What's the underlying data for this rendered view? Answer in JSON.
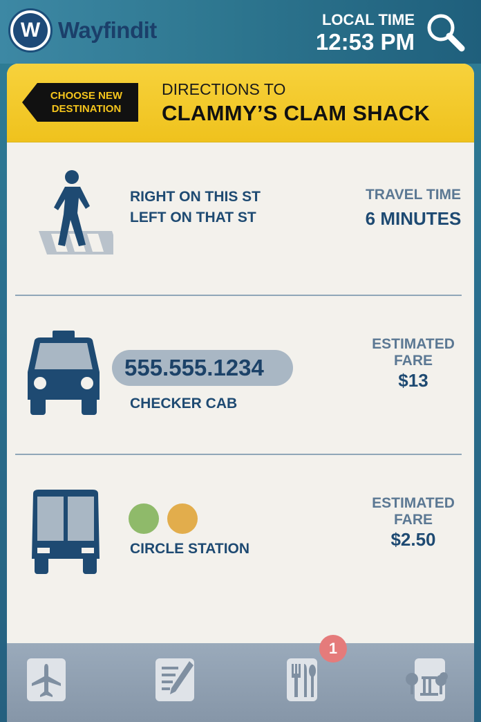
{
  "app": {
    "name": "Wayfindit",
    "logo_letter": "W"
  },
  "header": {
    "local_time_label": "LOCAL TIME",
    "local_time": "12:53 PM"
  },
  "destination": {
    "back_label_line1": "CHOOSE NEW",
    "back_label_line2": "DESTINATION",
    "label": "DIRECTIONS TO",
    "name": "CLAMMY’S CLAM SHACK"
  },
  "walk": {
    "line1": "RIGHT ON THIS ST",
    "line2": "LEFT ON THAT ST",
    "meta_label": "TRAVEL TIME",
    "meta_value": "6 MINUTES",
    "icon": "pedestrian-crosswalk-icon"
  },
  "cab": {
    "phone": "555.555.1234",
    "company": "CHECKER CAB",
    "meta_label_line1": "ESTIMATED",
    "meta_label_line2": "FARE",
    "meta_value": "$13",
    "icon": "taxi-icon"
  },
  "bus": {
    "station": "CIRCLE STATION",
    "line_colors": [
      "#8fba6a",
      "#e2ad4c"
    ],
    "meta_label_line1": "ESTIMATED",
    "meta_label_line2": "FARE",
    "meta_value": "$2.50",
    "icon": "bus-icon"
  },
  "tabs": [
    {
      "icon": "airplane-icon"
    },
    {
      "icon": "notepad-icon"
    },
    {
      "icon": "dining-icon",
      "badge": "1"
    },
    {
      "icon": "park-icon"
    }
  ],
  "colors": {
    "accent_yellow": "#efc21d",
    "primary_blue": "#1e4a72",
    "tabbar": "#8fa0b2"
  }
}
